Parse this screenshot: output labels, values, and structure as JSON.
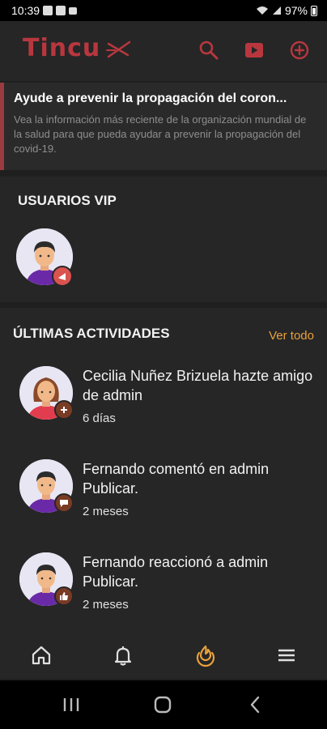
{
  "status": {
    "time": "10:39",
    "battery": "97%"
  },
  "app": {
    "name": "Tincu"
  },
  "toolbar": {
    "icons": [
      "search-icon",
      "youtube-icon",
      "add-circle-icon"
    ]
  },
  "notice": {
    "title": "Ayude a prevenir la propagación del coron...",
    "body": "Vea la información más reciente de la organización mundial de la salud para que pueda ayudar a prevenir la propagación del covid-19."
  },
  "vip": {
    "title": "USUARIOS VIP"
  },
  "activities": {
    "title": "ÚLTIMAS ACTIVIDADES",
    "view_all": "Ver todo",
    "items": [
      {
        "text": "Cecilia Nuñez Brizuela hazte amigo de admin",
        "time": "6 días",
        "badge": "add-friend-icon"
      },
      {
        "text": "Fernando comentó en admin Publicar.",
        "time": "2 meses",
        "badge": "comment-icon"
      },
      {
        "text": "Fernando reaccionó a admin Publicar.",
        "time": "2 meses",
        "badge": "reaction-icon"
      }
    ]
  },
  "nav": {
    "items": [
      "home-icon",
      "bell-icon",
      "activity-icon",
      "menu-icon"
    ],
    "active": "activity-icon"
  },
  "colors": {
    "brand": "#b8373f",
    "accent": "#e9a13b",
    "background": "#1f1f1f",
    "surface": "#262626"
  }
}
